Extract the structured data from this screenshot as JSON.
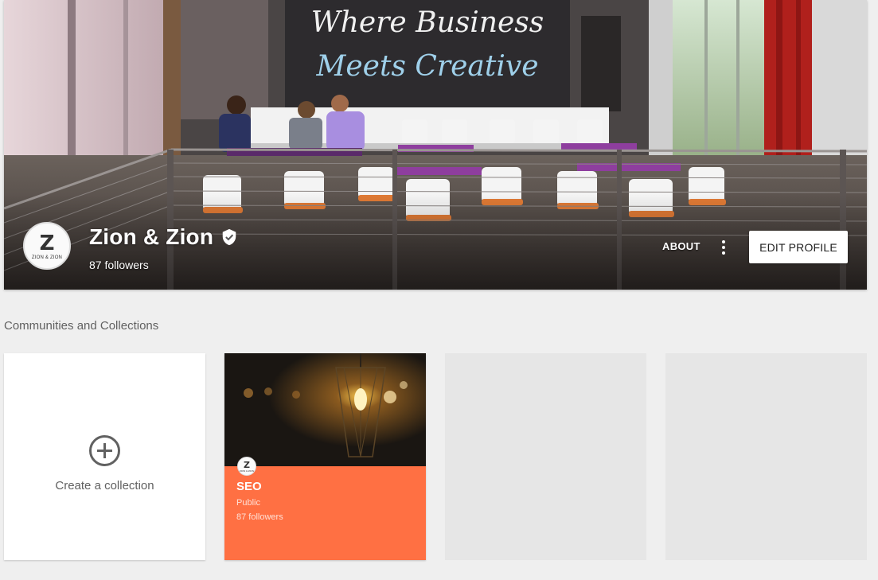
{
  "profile": {
    "name": "Zion & Zion",
    "followers": "87 followers",
    "avatar_logo_letter": "Z",
    "avatar_logo_text": "ZION & ZION",
    "verified_icon": "verified-shield-check-icon"
  },
  "cover": {
    "mural_text_line1": "Where Business",
    "mural_text_line2": "Meets Creative"
  },
  "actions": {
    "about_label": "ABOUT",
    "more_icon": "more-vertical-icon",
    "edit_profile_label": "EDIT PROFILE"
  },
  "section": {
    "title": "Communities and Collections"
  },
  "create_card": {
    "icon": "plus-circle-icon",
    "label": "Create a collection"
  },
  "collections": [
    {
      "title": "SEO",
      "visibility": "Public",
      "followers": "87 followers",
      "color": "#ff7043",
      "avatar_letter": "Z",
      "avatar_text": "ZION & ZION"
    }
  ],
  "colors": {
    "page_bg": "#efefef",
    "collection_accent": "#ff7043",
    "placeholder_card": "#e6e6e6"
  }
}
